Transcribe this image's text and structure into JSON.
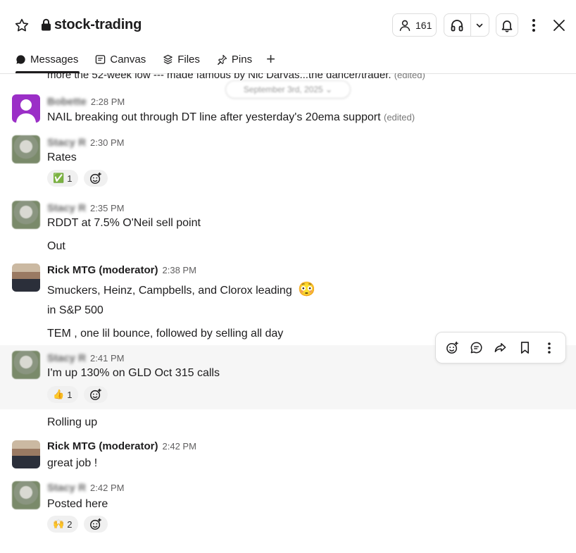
{
  "header": {
    "channel_name": "stock-trading",
    "member_count": "161",
    "tabs": [
      {
        "label": "Messages"
      },
      {
        "label": "Canvas"
      },
      {
        "label": "Files"
      },
      {
        "label": "Pins"
      }
    ],
    "add_tab": "+"
  },
  "feed": {
    "top_partial_text": "more the 52-week low --- made famous by Nic Darvas...the dancer/trader.",
    "top_partial_edited": "(edited)",
    "date_divider": "September 3rd, 2025",
    "messages": [
      {
        "sender": "Bobette",
        "time": "2:28 PM",
        "lines": [
          "NAIL breaking out through DT line after yesterday's 20ema support"
        ],
        "edited": "(edited)"
      },
      {
        "sender": "Stacy R",
        "time": "2:30 PM",
        "lines": [
          "Rates"
        ],
        "reactions": [
          {
            "emoji": "✅",
            "count": "1"
          }
        ]
      },
      {
        "sender": "Stacy R",
        "time": "2:35 PM",
        "lines": [
          "RDDT at 7.5% O'Neil sell point",
          "Out"
        ]
      },
      {
        "sender": "Rick MTG (moderator)",
        "time": "2:38 PM",
        "lines": [
          "Smuckers, Heinz, Campbells, and Clorox leading",
          "in S&P 500",
          "TEM , one lil bounce, followed by selling all day"
        ],
        "inline_emoji": "😳"
      },
      {
        "sender": "Stacy R",
        "time": "2:41 PM",
        "lines": [
          "I'm up 130% on GLD Oct 315 calls",
          "Rolling up"
        ],
        "reactions": [
          {
            "emoji": "👍",
            "count": "1"
          }
        ]
      },
      {
        "sender": "Rick MTG (moderator)",
        "time": "2:42 PM",
        "lines": [
          "great job !"
        ]
      },
      {
        "sender": "Stacy R",
        "time": "2:42 PM",
        "lines": [
          "Posted here"
        ],
        "reactions": [
          {
            "emoji": "🙌",
            "count": "2"
          }
        ]
      }
    ]
  },
  "hover_toolbar": {
    "actions": [
      "add-reaction",
      "reply-in-thread",
      "forward",
      "save",
      "more-actions"
    ]
  },
  "colors": {
    "purple_avatar": "#9b2fc7",
    "hover_background": "#f6f6f6",
    "text": "#1d1c1d",
    "muted": "#616061"
  }
}
